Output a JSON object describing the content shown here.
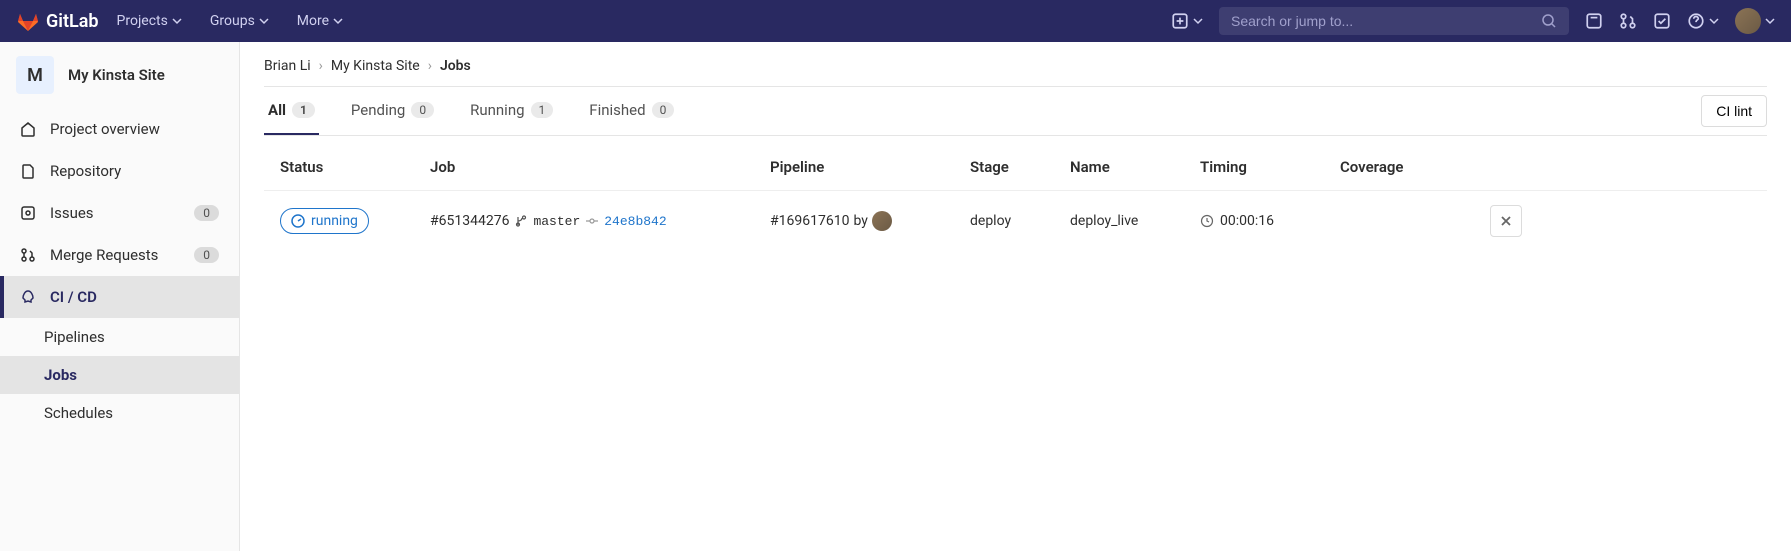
{
  "navbar": {
    "brand": "GitLab",
    "items": [
      "Projects",
      "Groups",
      "More"
    ],
    "search_placeholder": "Search or jump to..."
  },
  "sidebar": {
    "project_initial": "M",
    "project_name": "My Kinsta Site",
    "items": [
      {
        "label": "Project overview",
        "icon": "home"
      },
      {
        "label": "Repository",
        "icon": "doc"
      },
      {
        "label": "Issues",
        "icon": "issues",
        "badge": "0"
      },
      {
        "label": "Merge Requests",
        "icon": "merge",
        "badge": "0"
      },
      {
        "label": "CI / CD",
        "icon": "rocket",
        "active": true
      }
    ],
    "subitems": [
      {
        "label": "Pipelines"
      },
      {
        "label": "Jobs",
        "active": true
      },
      {
        "label": "Schedules"
      }
    ]
  },
  "breadcrumbs": [
    "Brian Li",
    "My Kinsta Site",
    "Jobs"
  ],
  "tabs": [
    {
      "label": "All",
      "count": "1",
      "active": true
    },
    {
      "label": "Pending",
      "count": "0"
    },
    {
      "label": "Running",
      "count": "1"
    },
    {
      "label": "Finished",
      "count": "0"
    }
  ],
  "ci_lint_label": "CI lint",
  "table": {
    "headers": [
      "Status",
      "Job",
      "Pipeline",
      "Stage",
      "Name",
      "Timing",
      "Coverage"
    ],
    "rows": [
      {
        "status": "running",
        "job_id": "#651344276",
        "branch": "master",
        "commit": "24e8b842",
        "pipeline_id": "#169617610",
        "pipeline_by": "by",
        "stage": "deploy",
        "name": "deploy_live",
        "timing": "00:00:16",
        "coverage": ""
      }
    ]
  }
}
